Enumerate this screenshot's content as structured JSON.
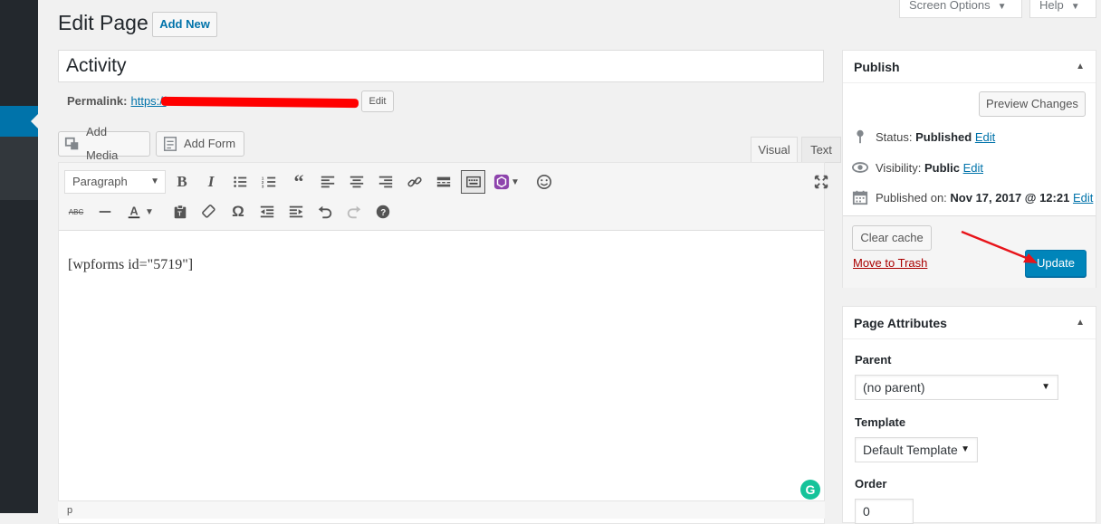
{
  "screen_options": {
    "screen_options_label": "Screen Options",
    "help_label": "Help"
  },
  "header": {
    "title": "Edit Page",
    "add_new": "Add New"
  },
  "post": {
    "title": "Activity",
    "permalink_label": "Permalink:",
    "permalink_url": "https://",
    "permalink_edit": "Edit"
  },
  "media": {
    "add_media": "Add Media",
    "add_form": "Add Form"
  },
  "editor_tabs": {
    "visual": "Visual",
    "text": "Text"
  },
  "toolbar": {
    "format": "Paragraph",
    "abc": "ABC"
  },
  "editor": {
    "content": "[wpforms id=\"5719\"]",
    "path": "p",
    "grammarly": "G"
  },
  "publish": {
    "title": "Publish",
    "preview": "Preview Changes",
    "status_label": "Status:",
    "status_value": "Published",
    "visibility_label": "Visibility:",
    "visibility_value": "Public",
    "published_label": "Published on:",
    "published_value": "Nov 17, 2017 @ 12:21",
    "edit_link": "Edit",
    "clear_cache": "Clear cache",
    "trash": "Move to Trash",
    "update": "Update"
  },
  "page_attributes": {
    "title": "Page Attributes",
    "parent_label": "Parent",
    "parent_value": "(no parent)",
    "template_label": "Template",
    "template_value": "Default Template",
    "order_label": "Order",
    "order_value": "0"
  },
  "colors": {
    "primary": "#0085ba",
    "link": "#0073aa",
    "sidebar": "#23282d",
    "annotation": "#e8141a"
  }
}
